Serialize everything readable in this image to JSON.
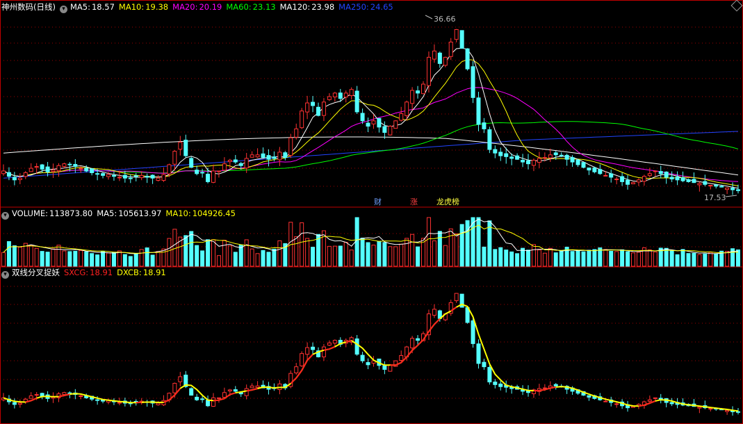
{
  "main": {
    "stock_name": "神州数码(日线)",
    "indicators": [
      {
        "label": "MA5:",
        "value": "18.57",
        "color": "#ffffff"
      },
      {
        "label": "MA10:",
        "value": "19.38",
        "color": "#ffff00"
      },
      {
        "label": "MA20:",
        "value": "20.19",
        "color": "#ff00ff"
      },
      {
        "label": "MA60:",
        "value": "23.13",
        "color": "#00ff00"
      },
      {
        "label": "MA120:",
        "value": "23.98",
        "color": "#ffffff"
      },
      {
        "label": "MA250:",
        "value": "24.65",
        "color": "#2244ff"
      }
    ],
    "high_label": "36.66",
    "low_label": "17.53"
  },
  "news_tags": [
    {
      "text": "财",
      "color": "#6fa0ff"
    },
    {
      "text": "涨",
      "color": "#ff4040"
    },
    {
      "text": "龙虎榜",
      "color": "#ffff40"
    }
  ],
  "volume": {
    "title": "VOLUME:",
    "value": "113873.80",
    "ma5_label": "MA5:",
    "ma5_value": "105613.97",
    "ma10_label": "MA10:",
    "ma10_value": "104926.45"
  },
  "indicator": {
    "title": "双线分叉捉妖",
    "sxcg_label": "SXCG:",
    "sxcg_value": "18.91",
    "dxcb_label": "DXCB:",
    "dxcb_value": "18.91"
  },
  "colors": {
    "up": "#ff3232",
    "down": "#54ffff",
    "grid": "#a00000",
    "ma5": "#ffffff",
    "ma10": "#ffff00",
    "ma20": "#ff00ff",
    "ma60": "#00ff00",
    "ma120": "#ffffff",
    "ma250": "#2244ff",
    "sxcg": "#ff2020",
    "dxcb": "#ffff00"
  },
  "chart_data": {
    "type": "candlestick",
    "price_axis_range": [
      17.0,
      37.5
    ],
    "closes": [
      19.8,
      19.2,
      18.8,
      19.0,
      19.6,
      20.1,
      20.3,
      20.0,
      19.7,
      19.9,
      20.4,
      20.6,
      20.5,
      20.3,
      20.1,
      19.8,
      19.6,
      19.5,
      19.3,
      19.4,
      19.2,
      19.1,
      19.0,
      19.0,
      19.2,
      19.3,
      19.1,
      19.0,
      19.0,
      19.4,
      20.5,
      22.0,
      23.0,
      21.5,
      20.2,
      19.5,
      19.6,
      18.6,
      19.8,
      19.8,
      20.6,
      21.0,
      20.8,
      20.4,
      21.2,
      21.6,
      21.6,
      21.3,
      21.1,
      21.2,
      21.9,
      21.3,
      23.5,
      24.5,
      26.5,
      27.4,
      27.1,
      26.0,
      27.5,
      28.1,
      28.5,
      27.9,
      28.5,
      28.9,
      26.4,
      25.4,
      24.8,
      25.4,
      24.7,
      24.1,
      24.8,
      25.4,
      26.2,
      27.5,
      28.8,
      28.5,
      29.5,
      32.5,
      33.2,
      31.8,
      32.5,
      34.2,
      35.6,
      33.5,
      31.2,
      28.0,
      25.0,
      24.5,
      22.2,
      21.8,
      21.5,
      21.4,
      21.2,
      21.1,
      20.8,
      20.6,
      21.0,
      21.2,
      21.3,
      21.6,
      21.6,
      21.5,
      21.1,
      20.8,
      20.5,
      20.2,
      19.9,
      19.7,
      19.5,
      19.3,
      19.1,
      18.9,
      18.6,
      18.3,
      18.5,
      18.8,
      19.2,
      19.5,
      19.8,
      19.5,
      19.1,
      18.9,
      18.8,
      18.7,
      18.6,
      18.5,
      18.4,
      18.3,
      18.2,
      18.1,
      18.0,
      17.9,
      17.7,
      17.6
    ],
    "volume_axis_max": 260000,
    "indicator_series": [
      "SXCG",
      "DXCB"
    ],
    "x_count": 130
  }
}
